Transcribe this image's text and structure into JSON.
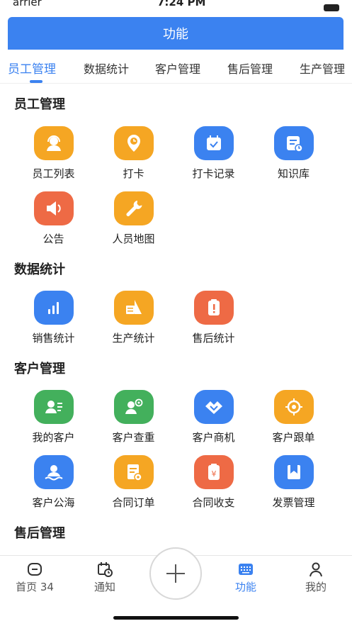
{
  "status_bar": {
    "carrier": "arrier",
    "time": "7:24 PM"
  },
  "header": {
    "title": "功能"
  },
  "tabs": [
    {
      "label": "员工管理",
      "active": true
    },
    {
      "label": "数据统计",
      "active": false
    },
    {
      "label": "客户管理",
      "active": false
    },
    {
      "label": "售后管理",
      "active": false
    },
    {
      "label": "生产管理",
      "active": false
    }
  ],
  "sections": {
    "staff": {
      "title": "员工管理",
      "items": [
        {
          "label": "员工列表",
          "icon": "headset-user-icon",
          "color": "#f5a623"
        },
        {
          "label": "打卡",
          "icon": "clock-pin-icon",
          "color": "#f5a623"
        },
        {
          "label": "打卡记录",
          "icon": "calendar-check-icon",
          "color": "#3b82f0"
        },
        {
          "label": "知识库",
          "icon": "document-clock-icon",
          "color": "#3b82f0"
        },
        {
          "label": "公告",
          "icon": "speaker-icon",
          "color": "#ee6a45"
        },
        {
          "label": "人员地图",
          "icon": "wrench-icon",
          "color": "#f5a623"
        }
      ]
    },
    "stats": {
      "title": "数据统计",
      "items": [
        {
          "label": "销售统计",
          "icon": "bar-chart-icon",
          "color": "#3b82f0"
        },
        {
          "label": "生产统计",
          "icon": "production-icon",
          "color": "#f5a623"
        },
        {
          "label": "售后统计",
          "icon": "clipboard-alert-icon",
          "color": "#ee6a45"
        }
      ]
    },
    "customers": {
      "title": "客户管理",
      "items": [
        {
          "label": "我的客户",
          "icon": "contact-card-icon",
          "color": "#43b05c"
        },
        {
          "label": "客户查重",
          "icon": "user-search-icon",
          "color": "#43b05c"
        },
        {
          "label": "客户商机",
          "icon": "handshake-icon",
          "color": "#3b82f0"
        },
        {
          "label": "客户跟单",
          "icon": "target-icon",
          "color": "#f5a623"
        },
        {
          "label": "客户公海",
          "icon": "user-sea-icon",
          "color": "#3b82f0"
        },
        {
          "label": "合同订单",
          "icon": "contract-icon",
          "color": "#f5a623"
        },
        {
          "label": "合同收支",
          "icon": "money-clipboard-icon",
          "color": "#ee6a45"
        },
        {
          "label": "发票管理",
          "icon": "invoice-bookmark-icon",
          "color": "#3b82f0"
        }
      ]
    },
    "after_sales": {
      "title": "售后管理"
    }
  },
  "bottom_nav": {
    "home": {
      "label": "首页 34",
      "icon": "home-icon"
    },
    "notice": {
      "label": "通知",
      "icon": "calendar-clock-icon"
    },
    "add": {
      "icon": "plus-icon"
    },
    "features": {
      "label": "功能",
      "icon": "keyboard-grid-icon",
      "active": true
    },
    "mine": {
      "label": "我的",
      "icon": "person-icon"
    }
  }
}
